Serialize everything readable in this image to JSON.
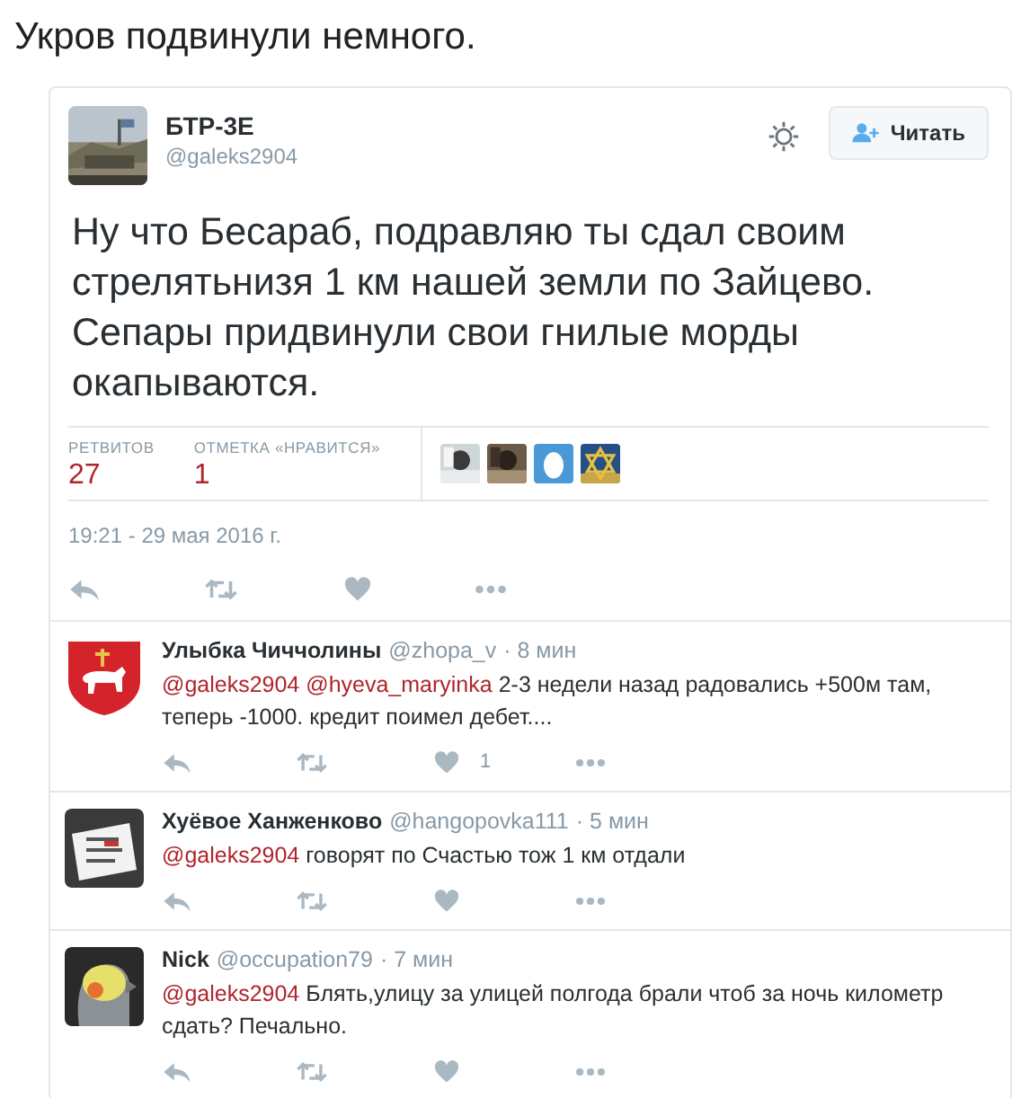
{
  "page_title": "Укров подвинули немного.",
  "tweet": {
    "author": {
      "name": "БТР-3Е",
      "handle": "@galeks2904"
    },
    "follow_button": "Читать",
    "text": "Ну что Бесараб, подравляю ты сдал своим стрелятьнизя 1 км нашей земли по Зайцево. Сепары придвинули свои гнилые морды окапываются.",
    "stats": [
      {
        "label": "РЕТВИТОВ",
        "value": "27"
      },
      {
        "label": "ОТМЕТКА «НРАВИТСЯ»",
        "value": "1"
      }
    ],
    "likers": [
      {
        "kind": "picture"
      },
      {
        "kind": "picture"
      },
      {
        "kind": "egg"
      },
      {
        "kind": "star"
      }
    ],
    "timestamp": "19:21 - 29 мая 2016 г."
  },
  "replies": [
    {
      "name": "Улыбка Чиччолины",
      "handle": "@zhopa_v",
      "time": "· 8 мин",
      "avatar": {
        "kind": "emblem"
      },
      "mentions": [
        "@galeks2904",
        "@hyeva_maryinka"
      ],
      "text": "2-3 недели назад радовались +500м там, теперь -1000. кредит поимел дебет....",
      "like_count": "1"
    },
    {
      "name": "Хуёвое Ханженково",
      "handle": "@hangopovka111",
      "time": "· 5 мин",
      "avatar": {
        "kind": "picture"
      },
      "mentions": [
        "@galeks2904"
      ],
      "text": "говорят по Счастью тож 1 км отдали"
    },
    {
      "name": "Nick",
      "handle": "@occupation79",
      "time": "· 7 мин",
      "avatar": {
        "kind": "bird"
      },
      "mentions": [
        "@galeks2904"
      ],
      "text": "Блять,улицу за улицей полгода брали чтоб за ночь километр сдать? Печально."
    }
  ]
}
